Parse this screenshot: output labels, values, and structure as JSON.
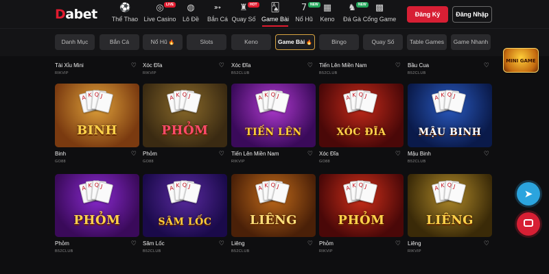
{
  "brand": {
    "logo_prefix": "D",
    "logo_rest": "abet"
  },
  "nav": [
    {
      "label": "Thể Thao",
      "icon": "soccer-ball-icon",
      "glyph": "⚽"
    },
    {
      "label": "Live Casino",
      "icon": "casino-chip-icon",
      "glyph": "◎",
      "badge": "LIVE"
    },
    {
      "label": "Lô Đề",
      "icon": "lottery-ball-icon",
      "glyph": "◍"
    },
    {
      "label": "Bắn Cá",
      "icon": "fish-icon",
      "glyph": "➳"
    },
    {
      "label": "Quay Số",
      "icon": "spin-wheel-icon",
      "glyph": "♜",
      "badge": "HOT"
    },
    {
      "label": "Game Bài",
      "icon": "playing-cards-icon",
      "glyph": "🂡",
      "active": true
    },
    {
      "label": "Nổ Hũ",
      "icon": "slot-seven-icon",
      "glyph": "7",
      "badge": "NEW"
    },
    {
      "label": "Keno",
      "icon": "keno-grid-icon",
      "glyph": "▦"
    },
    {
      "label": "Đá Gà",
      "icon": "rooster-icon",
      "glyph": "♞",
      "badge": "NEW"
    },
    {
      "label": "Cổng Game",
      "icon": "game-portal-icon",
      "glyph": "▩"
    }
  ],
  "auth": {
    "register": "Đăng Ký",
    "login": "Đăng Nhập"
  },
  "categories": [
    {
      "label": "Danh Mục"
    },
    {
      "label": "Bắn Cá"
    },
    {
      "label": "Nổ Hũ",
      "fire": true
    },
    {
      "label": "Slots"
    },
    {
      "label": "Keno"
    },
    {
      "label": "Game Bài",
      "fire": true,
      "active": true
    },
    {
      "label": "Bingo"
    },
    {
      "label": "Quay Số"
    },
    {
      "label": "Table Games"
    },
    {
      "label": "Game Nhanh"
    }
  ],
  "partial_row": [
    {
      "name": "Tài Xỉu Mini",
      "provider": "RIKVIP"
    },
    {
      "name": "Xóc Đĩa",
      "provider": "RIKVIP"
    },
    {
      "name": "Xóc Đĩa",
      "provider": "B52CLUB"
    },
    {
      "name": "Tiến Lên Miền Nam",
      "provider": "B52CLUB"
    },
    {
      "name": "Bầu Cua",
      "provider": "B52CLUB"
    }
  ],
  "row1": [
    {
      "name": "Binh",
      "provider": "GO88",
      "art": "BINH",
      "bg": "#7a3a10",
      "bg2": "#e0a23a",
      "text": "#ffd24a"
    },
    {
      "name": "Phỏm",
      "provider": "GO88",
      "art": "PHỎM",
      "bg": "#3a2a12",
      "bg2": "#8a6a2a",
      "text": "#ff4a6a"
    },
    {
      "name": "Tiến Lên Miền Nam",
      "provider": "RIKVIP",
      "art": "TIẾN LÊN",
      "bg": "#3a0a5a",
      "bg2": "#b03ad0",
      "text": "#ffcf3a"
    },
    {
      "name": "Xóc Đĩa",
      "provider": "GO88",
      "art": "XÓC ĐĨA",
      "bg": "#4a0808",
      "bg2": "#c42a1a",
      "text": "#ffd24a"
    },
    {
      "name": "Mậu Binh",
      "provider": "B52CLUB",
      "art": "MẬU BINH",
      "bg": "#0a1a4a",
      "bg2": "#2a5ac0",
      "text": "#ffffff"
    }
  ],
  "row2": [
    {
      "name": "Phỏm",
      "provider": "B52CLUB",
      "art": "PHỎM",
      "bg": "#3a0a5a",
      "bg2": "#8a2ad0",
      "text": "#ffd24a"
    },
    {
      "name": "Sâm Lốc",
      "provider": "B52CLUB",
      "art": "SÂM LỐC",
      "bg": "#1a0a4a",
      "bg2": "#5a2aa0",
      "text": "#ffcf3a"
    },
    {
      "name": "Liêng",
      "provider": "B52CLUB",
      "art": "LIÊNG",
      "bg": "#4a2008",
      "bg2": "#c06a1a",
      "text": "#ffe07a"
    },
    {
      "name": "Phỏm",
      "provider": "RIKVIP",
      "art": "PHỎM",
      "bg": "#4a0808",
      "bg2": "#d0301a",
      "text": "#ffd24a"
    },
    {
      "name": "Liêng",
      "provider": "RIKVIP",
      "art": "LIÊNG",
      "bg": "#3a2a08",
      "bg2": "#b08a2a",
      "text": "#ffd24a"
    }
  ],
  "widgets": {
    "mini_game": "MINI GAME",
    "telegram_glyph": "➤"
  },
  "colors": {
    "accent": "#d71f34",
    "active_border": "#d9a441",
    "background": "#0e0e10"
  }
}
